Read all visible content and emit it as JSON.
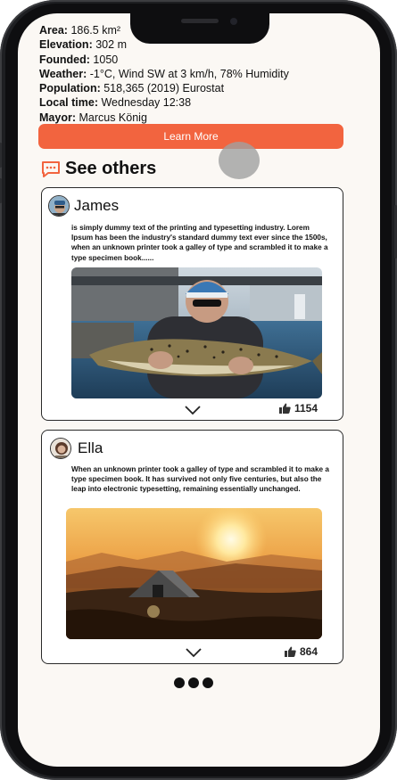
{
  "city_info": [
    {
      "label": "Area:",
      "value": "186.5 km²"
    },
    {
      "label": "Elevation:",
      "value": "302 m"
    },
    {
      "label": "Founded:",
      "value": "1050"
    },
    {
      "label": "Weather:",
      "value": "-1°C, Wind SW at 3 km/h, 78% Humidity"
    },
    {
      "label": "Population:",
      "value": "518,365 (2019) Eurostat"
    },
    {
      "label": "Local time:",
      "value": "Wednesday 12:38"
    },
    {
      "label": "Mayor:",
      "value": "Marcus König"
    }
  ],
  "learn_more_label": "Learn More",
  "section_title": "See others",
  "posts": [
    {
      "user": "James",
      "text": " is simply dummy text of the printing and typesetting industry. Lorem Ipsum has been the industry's standard dummy text ever since the 1500s, when an unknown printer took a galley of type and scrambled it to make a type specimen book......",
      "likes": "1154",
      "photo_icon": "fish-photo"
    },
    {
      "user": "Ella",
      "text": "When an unknown printer took a galley of type and scrambled it to make a type specimen book. It has survived not only five centuries, but also the leap into electronic typesetting, remaining essentially unchanged.",
      "likes": "864",
      "photo_icon": "tent-sunset-photo"
    }
  ],
  "colors": {
    "accent": "#f2643f",
    "screen_bg": "#fbf8f4"
  }
}
